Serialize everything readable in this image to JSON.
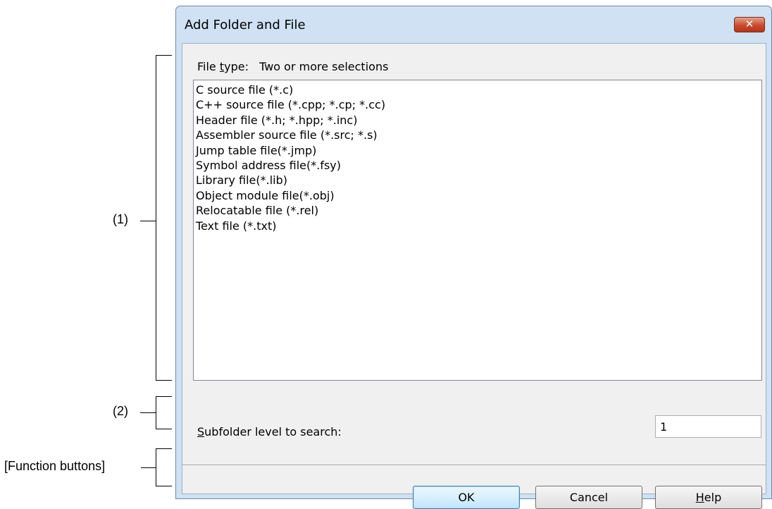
{
  "annotations": {
    "callout_1": "(1)",
    "callout_2": "(2)",
    "callout_3": "[Function buttons]"
  },
  "dialog": {
    "title": "Add Folder and File",
    "close_glyph": "✕",
    "file_type": {
      "label_prefix": "File ",
      "label_mnemonic": "t",
      "label_suffix": "ype:",
      "value": "Two or more selections"
    },
    "file_types": [
      "C source file (*.c)",
      "C++ source file (*.cpp; *.cp; *.cc)",
      "Header file (*.h; *.hpp; *.inc)",
      "Assembler source file (*.src; *.s)",
      "Jump table file(*.jmp)",
      "Symbol address file(*.fsy)",
      "Library file(*.lib)",
      "Object module file(*.obj)",
      "Relocatable file (*.rel)",
      "Text file (*.txt)"
    ],
    "subfolder": {
      "label_mnemonic": "S",
      "label_rest": "ubfolder level to search:",
      "value": "1"
    },
    "buttons": {
      "ok": "OK",
      "cancel": "Cancel",
      "help_mnemonic": "H",
      "help_rest": "elp"
    }
  },
  "colors": {
    "frame": "#cfe1f3",
    "client": "#f0f0f0",
    "close": "#c74a2c"
  }
}
